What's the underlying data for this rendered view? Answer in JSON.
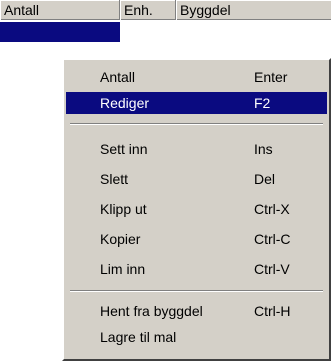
{
  "grid": {
    "columns": [
      "Antall",
      "Enh.",
      "Byggdel"
    ],
    "selected_row": {
      "antall": "",
      "enh": "",
      "byggdel": ""
    }
  },
  "context_menu": {
    "items": [
      {
        "label": "Antall",
        "shortcut": "Enter",
        "highlighted": false
      },
      {
        "label": "Rediger",
        "shortcut": "F2",
        "highlighted": true
      },
      {
        "label": "Sett inn",
        "shortcut": "Ins",
        "highlighted": false
      },
      {
        "label": "Slett",
        "shortcut": "Del",
        "highlighted": false
      },
      {
        "label": "Klipp ut",
        "shortcut": "Ctrl-X",
        "highlighted": false
      },
      {
        "label": "Kopier",
        "shortcut": "Ctrl-C",
        "highlighted": false
      },
      {
        "label": "Lim inn",
        "shortcut": "Ctrl-V",
        "highlighted": false
      },
      {
        "label": "Hent fra byggdel",
        "shortcut": "Ctrl-H",
        "highlighted": false
      },
      {
        "label": "Lagre til mal",
        "shortcut": "",
        "highlighted": false
      }
    ]
  },
  "colors": {
    "menu_background": "#d4d0c8",
    "highlight": "#0a0a80",
    "highlight_text": "#ffffff"
  }
}
